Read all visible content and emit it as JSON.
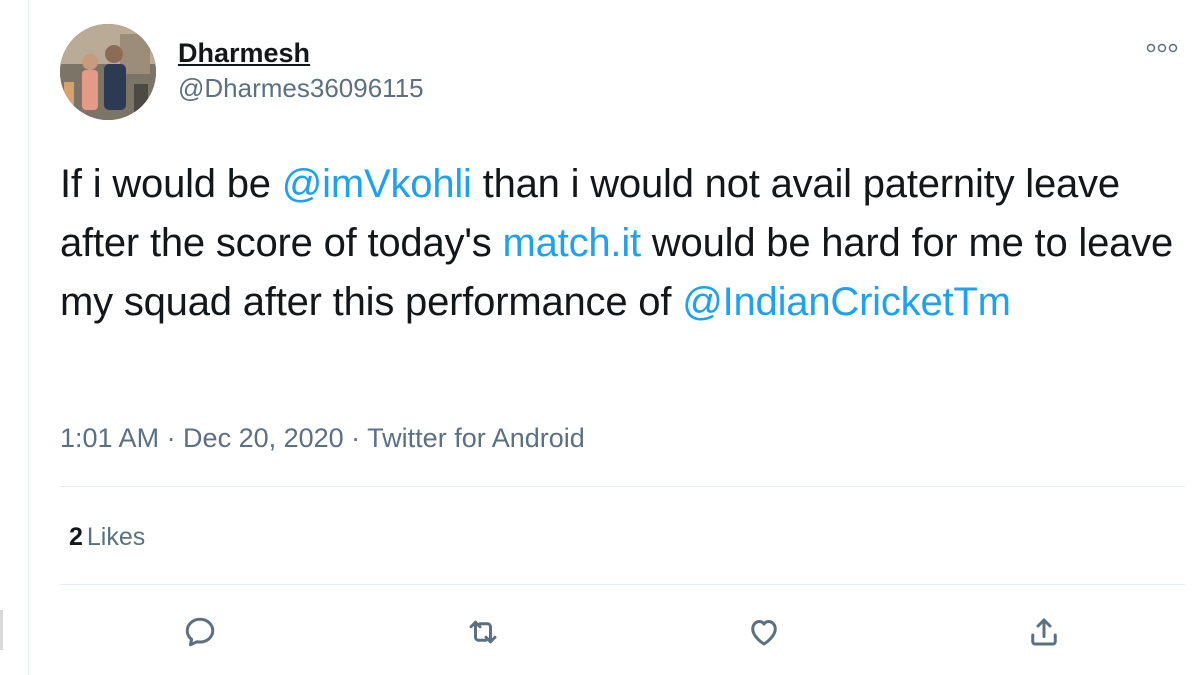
{
  "author": {
    "display_name": "Dharmesh",
    "handle": "@Dharmes36096115"
  },
  "tweet": {
    "segments": [
      {
        "text": "If i would be ",
        "link": false
      },
      {
        "text": "@imVkohli",
        "link": true,
        "name": "mention-imvkohli"
      },
      {
        "text": " than i would not avail paternity leave after the score of today's ",
        "link": false
      },
      {
        "text": "match.it",
        "link": true,
        "name": "link-match-it"
      },
      {
        "text": " would be hard for me to leave my squad after this performance of ",
        "link": false
      },
      {
        "text": "@IndianCricketTm",
        "link": true,
        "name": "mention-indiancrickettm"
      }
    ],
    "meta": "1:01 AM · Dec 20, 2020 · Twitter for Android"
  },
  "likes": {
    "count": "2",
    "label": "Likes"
  },
  "actions": [
    {
      "name": "reply-icon"
    },
    {
      "name": "retweet-icon"
    },
    {
      "name": "like-icon"
    },
    {
      "name": "share-icon"
    }
  ],
  "colors": {
    "link": "#1da1f2",
    "text": "#14171a",
    "secondary": "#5b7083",
    "divider": "#e6ecf0"
  }
}
